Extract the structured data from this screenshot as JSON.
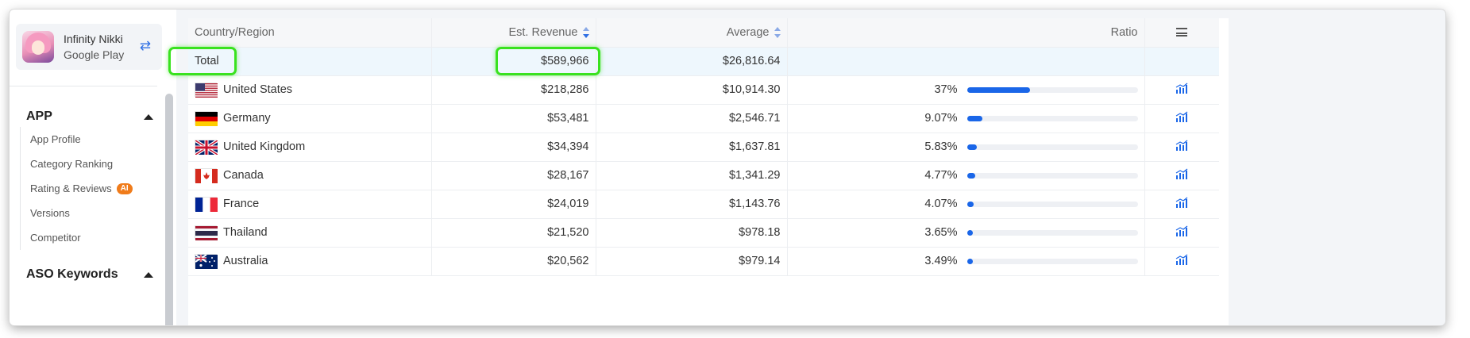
{
  "app": {
    "name": "Infinity Nikki",
    "store": "Google Play"
  },
  "sidebar": {
    "sections": [
      {
        "title": "APP",
        "items": [
          {
            "label": "App Profile"
          },
          {
            "label": "Category Ranking"
          },
          {
            "label": "Rating & Reviews",
            "badge": "AI"
          },
          {
            "label": "Versions"
          },
          {
            "label": "Competitor"
          }
        ]
      },
      {
        "title": "ASO Keywords"
      }
    ]
  },
  "table": {
    "headers": {
      "country": "Country/Region",
      "revenue": "Est. Revenue",
      "average": "Average",
      "ratio": "Ratio"
    },
    "total": {
      "label": "Total",
      "revenue": "$589,966",
      "average": "$26,816.64"
    },
    "rows": [
      {
        "country": "United States",
        "flag": "us",
        "revenue": "$218,286",
        "average": "$10,914.30",
        "ratio": "37%",
        "ratio_value": 37
      },
      {
        "country": "Germany",
        "flag": "de",
        "revenue": "$53,481",
        "average": "$2,546.71",
        "ratio": "9.07%",
        "ratio_value": 9.07
      },
      {
        "country": "United Kingdom",
        "flag": "gb",
        "revenue": "$34,394",
        "average": "$1,637.81",
        "ratio": "5.83%",
        "ratio_value": 5.83
      },
      {
        "country": "Canada",
        "flag": "ca",
        "revenue": "$28,167",
        "average": "$1,341.29",
        "ratio": "4.77%",
        "ratio_value": 4.77
      },
      {
        "country": "France",
        "flag": "fr",
        "revenue": "$24,019",
        "average": "$1,143.76",
        "ratio": "4.07%",
        "ratio_value": 4.07
      },
      {
        "country": "Thailand",
        "flag": "th",
        "revenue": "$21,520",
        "average": "$978.18",
        "ratio": "3.65%",
        "ratio_value": 3.65
      },
      {
        "country": "Australia",
        "flag": "au",
        "revenue": "$20,562",
        "average": "$979.14",
        "ratio": "3.49%",
        "ratio_value": 3.49
      }
    ]
  },
  "colors": {
    "accent": "#1a66e8",
    "highlight": "#39e21f",
    "badge": "#f07c1b"
  }
}
